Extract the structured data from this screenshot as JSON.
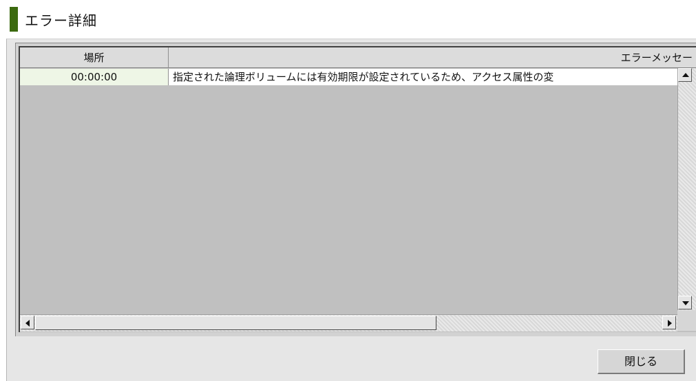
{
  "dialog": {
    "title": "エラー詳細",
    "accent_color": "#3c6a0f"
  },
  "table": {
    "columns": [
      "場所",
      "エラーメッセージ"
    ],
    "header_visible": {
      "location": "場所",
      "message": "エラーメッセー"
    },
    "rows": [
      {
        "location": "00:00:00",
        "message": "指定された論理ボリュームには有効期限が設定されているため、アクセス属性の変"
      }
    ]
  },
  "scrollbars": {
    "vertical_icons": [
      "arrow-up-icon",
      "arrow-down-icon"
    ],
    "horizontal_icons": [
      "arrow-left-icon",
      "arrow-right-icon"
    ]
  },
  "footer": {
    "close_label": "閉じる"
  }
}
